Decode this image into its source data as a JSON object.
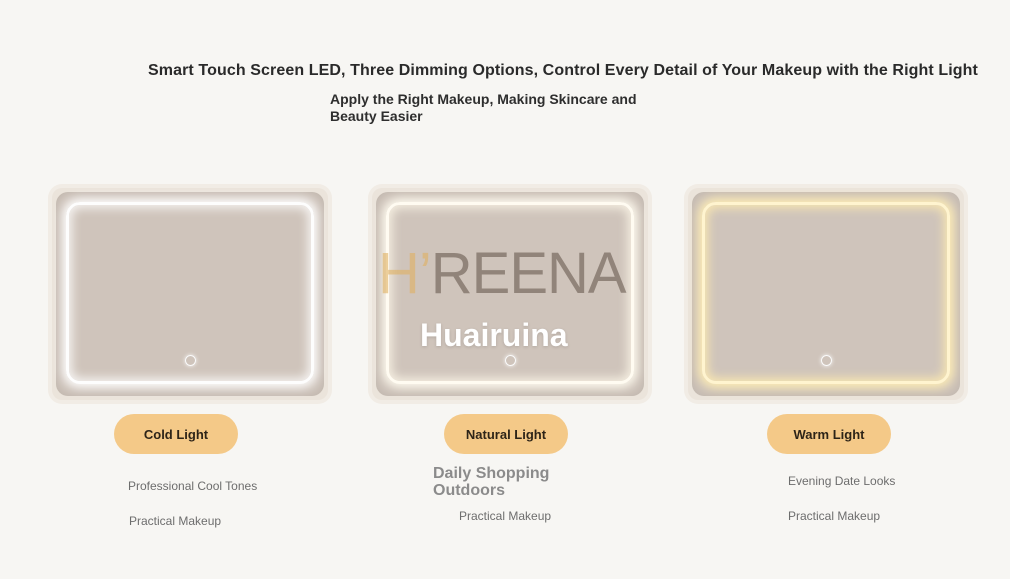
{
  "header": {
    "headline": "Smart Touch Screen LED, Three Dimming Options, Control Every Detail of Your Makeup with the Right Light",
    "subheadline": "Apply the Right Makeup, Making Skincare and Beauty Easier"
  },
  "watermark": {
    "logo_h": "H’",
    "logo_rest": "REENA",
    "text": "Huairuina"
  },
  "modes": [
    {
      "label": "Cold Light",
      "features": [
        "Professional Cool Tones",
        "Practical Makeup"
      ]
    },
    {
      "label": "Natural Light",
      "features": [
        "Daily Shopping Outdoors",
        "Practical Makeup"
      ]
    },
    {
      "label": "Warm Light",
      "features": [
        "Evening Date Looks",
        "Practical Makeup"
      ]
    }
  ],
  "colors": {
    "background": "#f7f6f3",
    "pill": "#f4c988",
    "mirror": "#cfc4bb",
    "cold_led": "#fdfdfd",
    "natural_led": "#fffbf1",
    "warm_led": "#fff4cf"
  },
  "icons": {
    "touch_button": "power-touch-icon"
  }
}
